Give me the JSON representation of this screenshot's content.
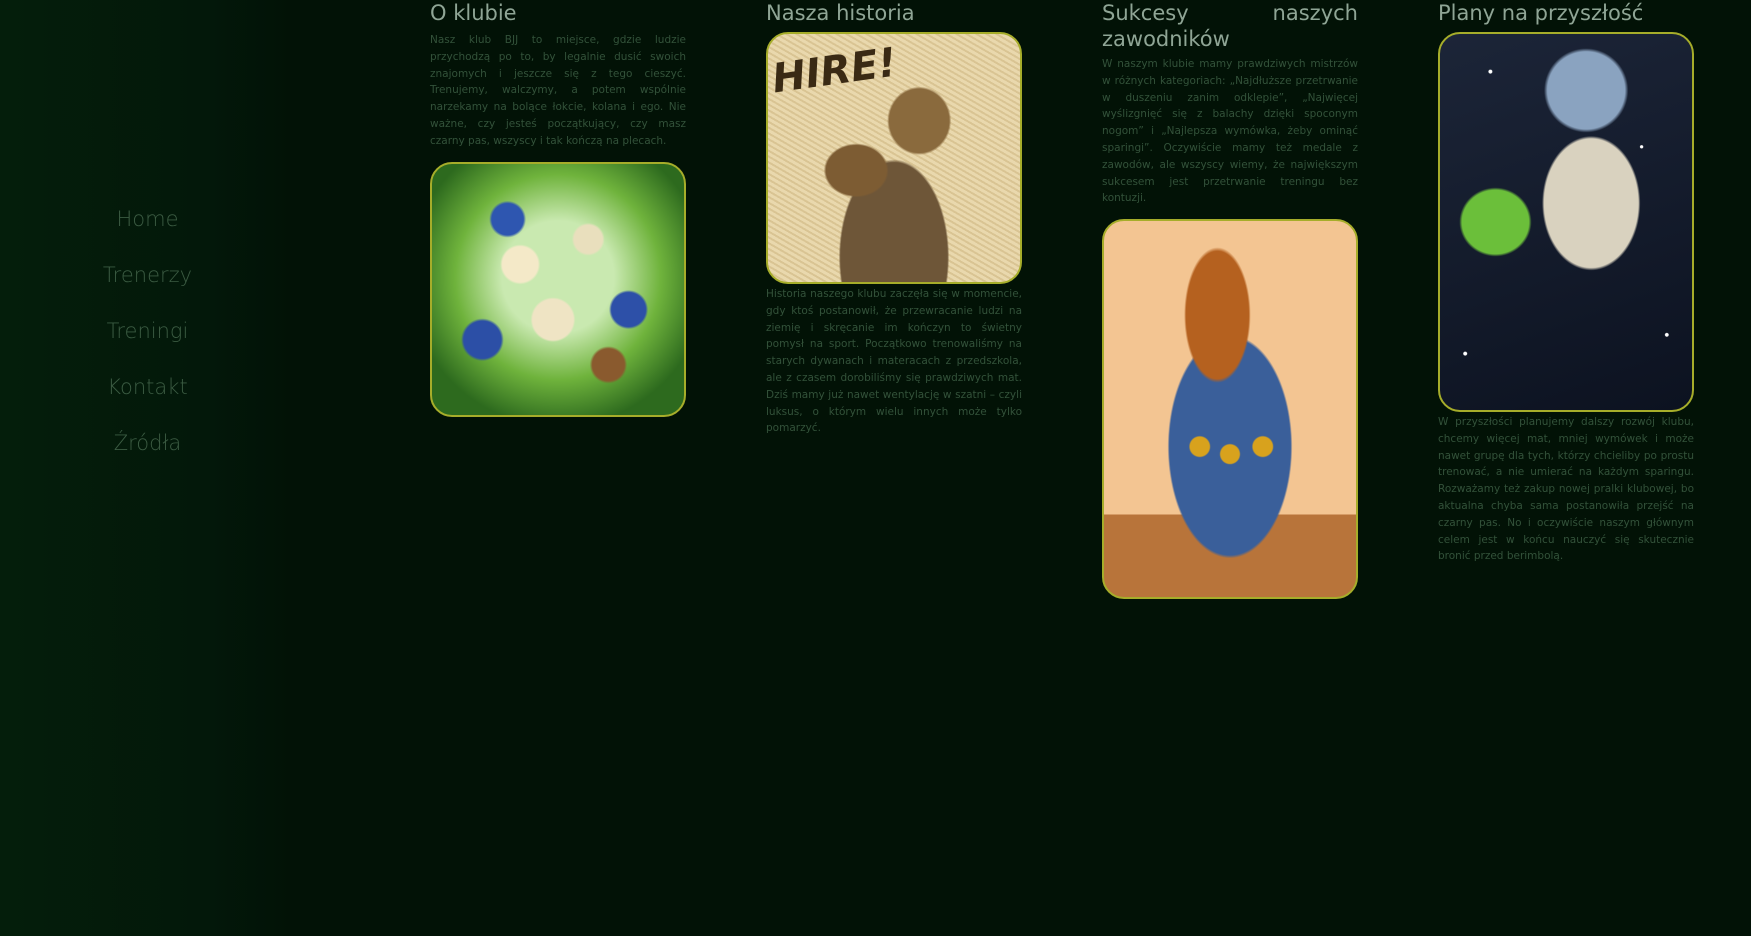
{
  "nav": {
    "items": [
      {
        "label": "Home"
      },
      {
        "label": "Trenerzy"
      },
      {
        "label": "Treningi"
      },
      {
        "label": "Kontakt"
      },
      {
        "label": "Źródła"
      }
    ]
  },
  "sections": [
    {
      "title": "O klubie",
      "text": "Nasz klub BJJ to miejsce, gdzie ludzie przychodzą po to, by legalnie dusić swoich znajomych i jeszcze się z tego cieszyć. Trenujemy, walczymy, a potem wspólnie narzekamy na bolące łokcie, kolana i ego. Nie ważne, czy jesteś początkujący, czy masz czarny pas, wszyscy i tak kończą na plecach."
    },
    {
      "title": "Nasza historia",
      "image_caption": "HIRE!",
      "text": "Historia naszego klubu zaczęła się w momencie, gdy ktoś postanowił, że przewracanie ludzi na ziemię i skręcanie im kończyn to świetny pomysł na sport. Początkowo trenowaliśmy na starych dywanach i materacach z przedszkola, ale z czasem dorobiliśmy się prawdziwych mat. Dziś mamy już nawet wentylację w szatni – czyli luksus, o którym wielu innych może tylko pomarzyć."
    },
    {
      "title": "Sukcesy naszych zawodników",
      "text": "W naszym klubie mamy prawdziwych mistrzów w różnych kategoriach: „Najdłuższe przetrwanie w duszeniu zanim odklepie”, „Najwięcej wyślizgnięć się z balachy dzięki spoconym nogom” i „Najlepsza wymówka, żeby ominąć sparingi”. Oczywiście mamy też medale z zawodów, ale wszyscy wiemy, że największym sukcesem jest przetrwanie treningu bez kontuzji."
    },
    {
      "title": "Plany na przyszłość",
      "text": "W przyszłości planujemy dalszy rozwój klubu, chcemy więcej mat, mniej wymówek i może nawet grupę dla tych, którzy chcieliby po prostu trenować, a nie umierać na każdym sparingu. Rozważamy też zakup nowej pralki klubowej, bo aktualna chyba sama postanowiła przejść na czarny pas. No i oczywiście naszym głównym celem jest w końcu nauczyć się skutecznie bronić przed berimbolą."
    }
  ],
  "colors": {
    "background": "#021206",
    "heading": "#8fa595",
    "body_text": "#33523a",
    "nav_text": "#3b5b42",
    "image_border": "#a6ad2a"
  }
}
